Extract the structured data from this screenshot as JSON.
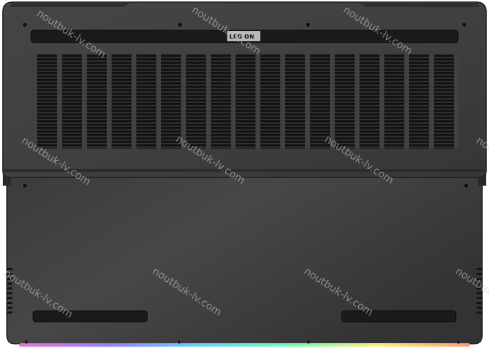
{
  "photo": {
    "brand_logo": "LEG ON",
    "watermark": "noutbuk-lv.com",
    "body_color": "#3a3a3c",
    "light_bar_colors": [
      "#e86cd6",
      "#8f7cff",
      "#5fd3ff",
      "#6cffb0",
      "#fff07a",
      "#ff9b6a"
    ]
  }
}
